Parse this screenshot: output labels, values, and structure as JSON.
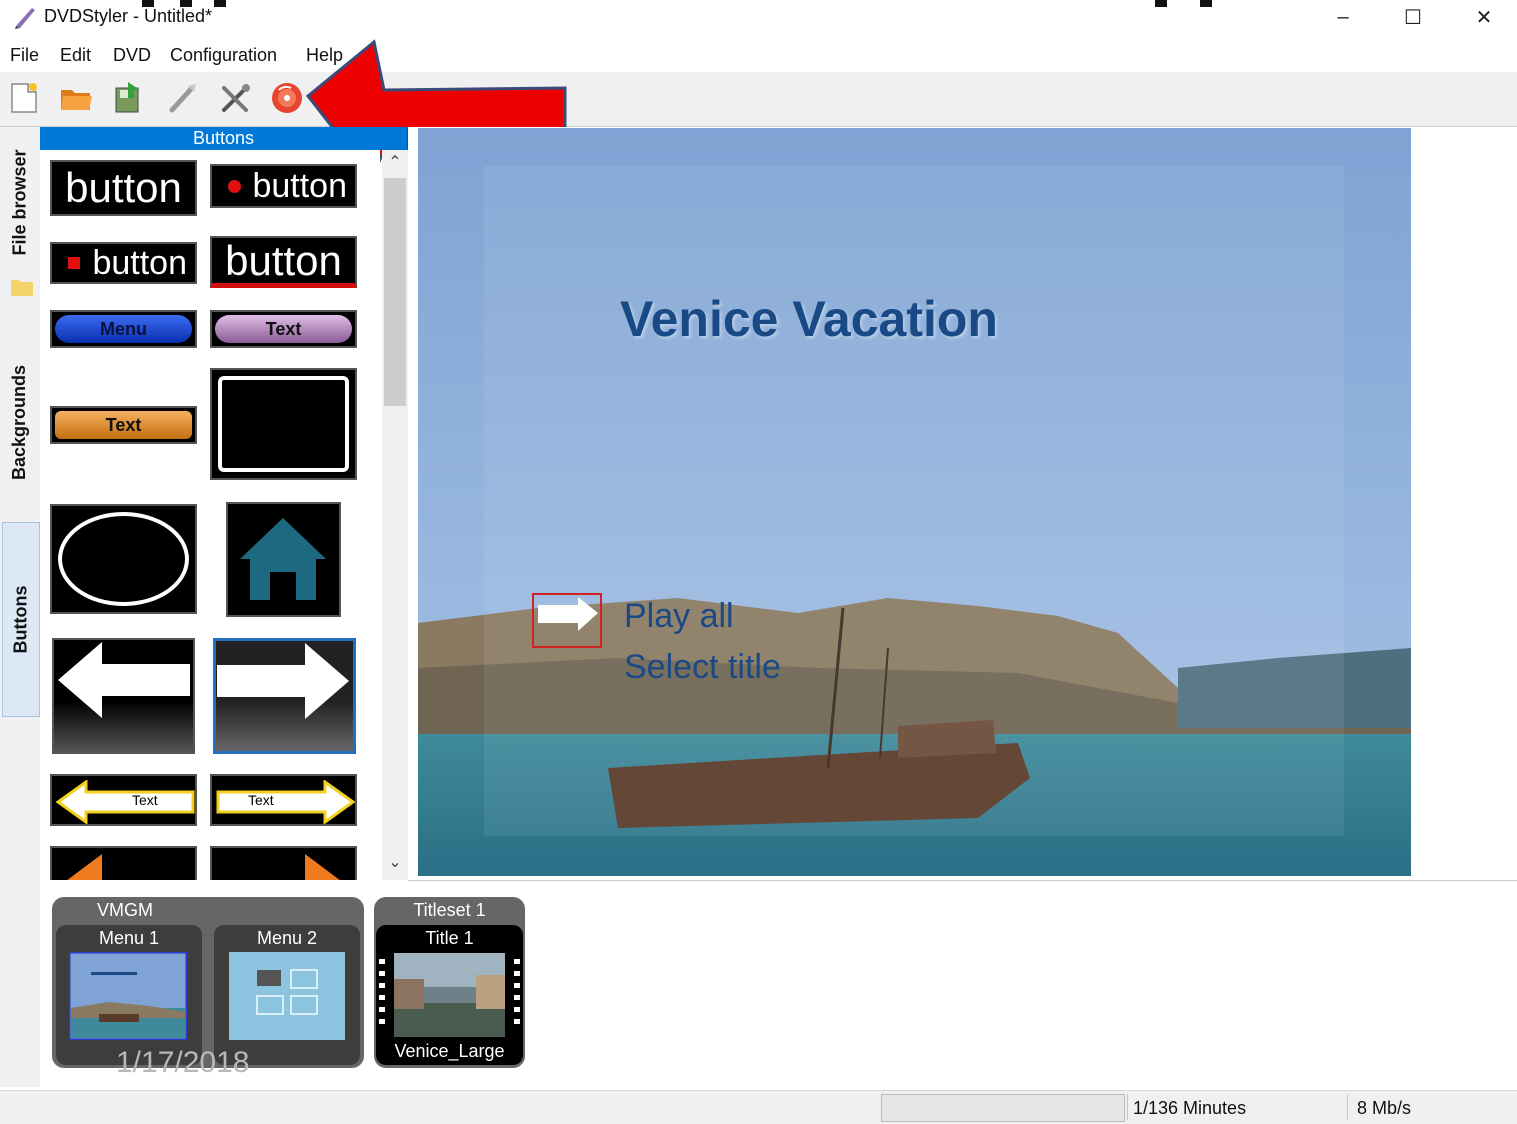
{
  "window": {
    "title": "DVDStyler - Untitled*",
    "controls": {
      "minimize": "–",
      "maximize": "☐",
      "close": "✕"
    }
  },
  "menubar": {
    "items": [
      {
        "label": "File"
      },
      {
        "label": "Edit"
      },
      {
        "label": "DVD"
      },
      {
        "label": "Configuration"
      },
      {
        "label": "Help"
      }
    ]
  },
  "toolbar": {
    "tools": [
      {
        "icon": "new-file-icon"
      },
      {
        "icon": "open-folder-icon"
      },
      {
        "icon": "save-icon"
      },
      {
        "icon": "run-wizard-icon"
      },
      {
        "icon": "settings-tools-icon"
      },
      {
        "icon": "burn-dvd-icon"
      }
    ]
  },
  "left_tabs": {
    "file_browser": "File browser",
    "backgrounds": "Backgrounds",
    "buttons": "Buttons"
  },
  "buttons_panel": {
    "header": "Buttons",
    "samples": {
      "b1": "button",
      "b2": "button",
      "b3": "button",
      "b4": "button",
      "menu": "Menu",
      "text_purple": "Text",
      "text_orange": "Text",
      "arrow_left_text": "Text",
      "arrow_right_text": "Text"
    },
    "scroll_up": "⌃",
    "scroll_down": "⌄"
  },
  "preview": {
    "menu_title": "Venice Vacation",
    "items": [
      "Play all",
      "Select title"
    ]
  },
  "menus_panel": {
    "vmgm_label": "VMGM",
    "menu1_label": "Menu 1",
    "menu2_label": "Menu 2",
    "titleset_label": "Titleset 1",
    "title1_label": "Title 1",
    "title1_file": "Venice_Large",
    "date_watermark": "1/17/2018"
  },
  "statusbar": {
    "minutes": "1/136 Minutes",
    "rate": "8 Mb/s"
  },
  "colors": {
    "accent": "#0078d7",
    "annotation_arrow": "#ee0000",
    "menu_title_text": "#1a4a86"
  }
}
